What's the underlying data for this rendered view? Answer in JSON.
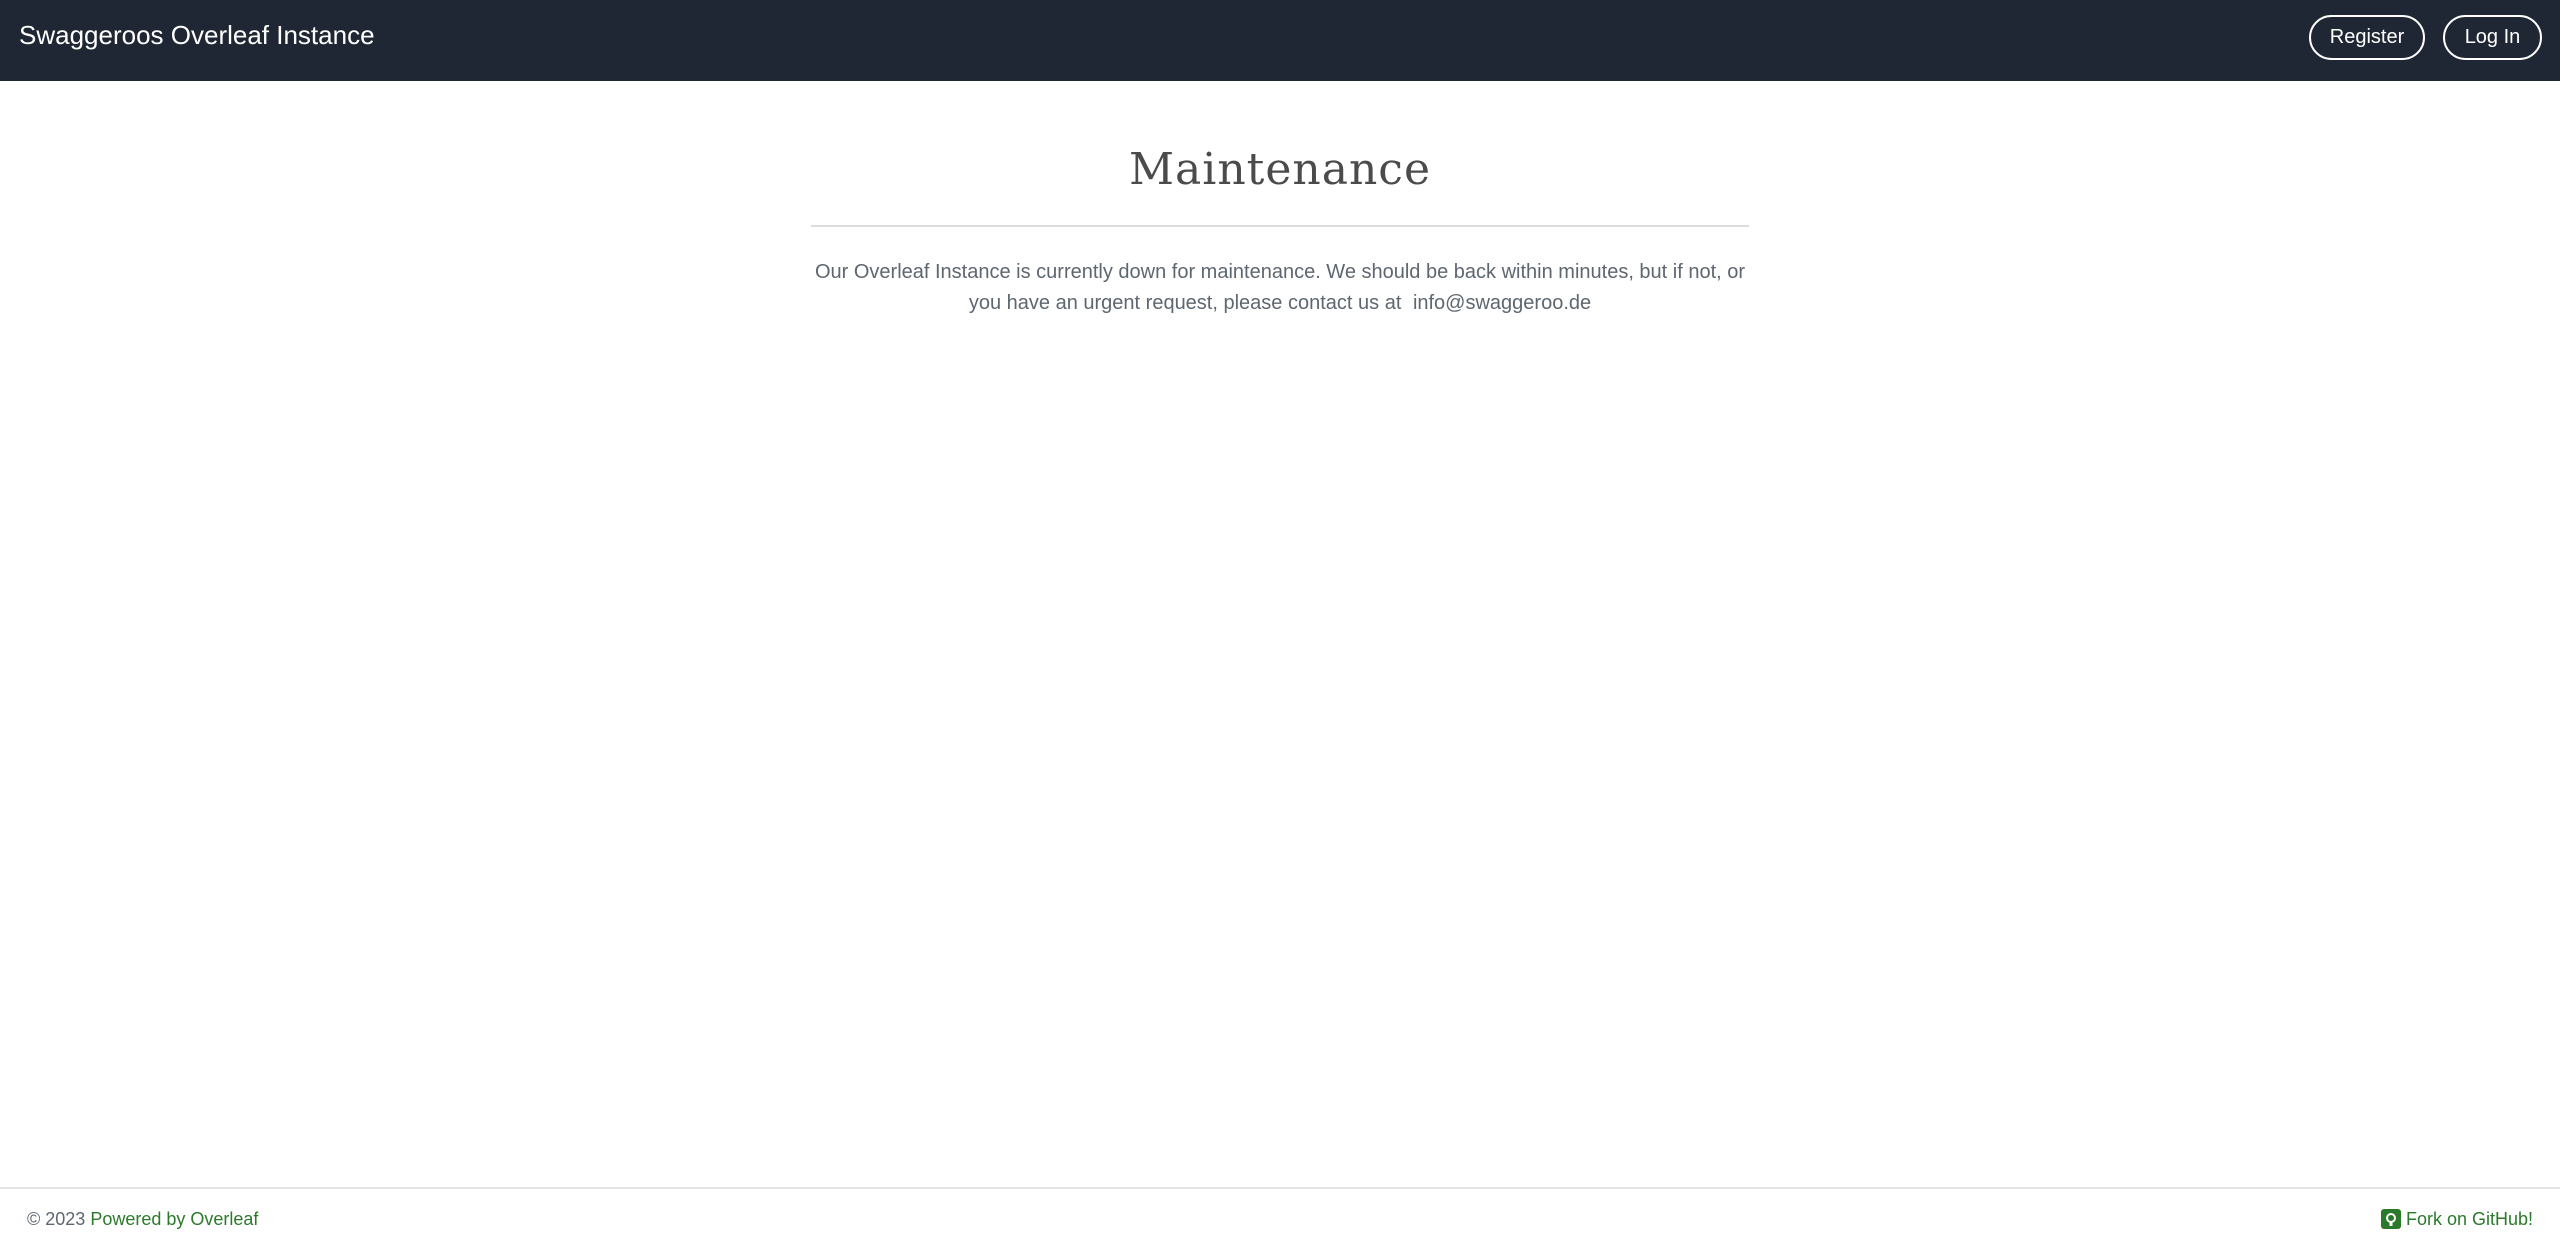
{
  "navbar": {
    "brand": "Swaggeroos Overleaf Instance",
    "register_label": "Register",
    "login_label": "Log In"
  },
  "main": {
    "title": "Maintenance",
    "message": "Our Overleaf Instance is currently down for maintenance. We should be back within minutes, but if not, or you have an urgent request, please contact us at ",
    "email": "info@swaggeroo.de"
  },
  "footer": {
    "copyright": "© 2023",
    "powered_by": "Powered by Overleaf",
    "fork_label": "Fork on GitHub!",
    "fork_icon": "github-icon"
  },
  "colors": {
    "navbar_bg": "#1f2734",
    "link_green": "#2b7a2b",
    "text_gray": "#5e6670"
  }
}
